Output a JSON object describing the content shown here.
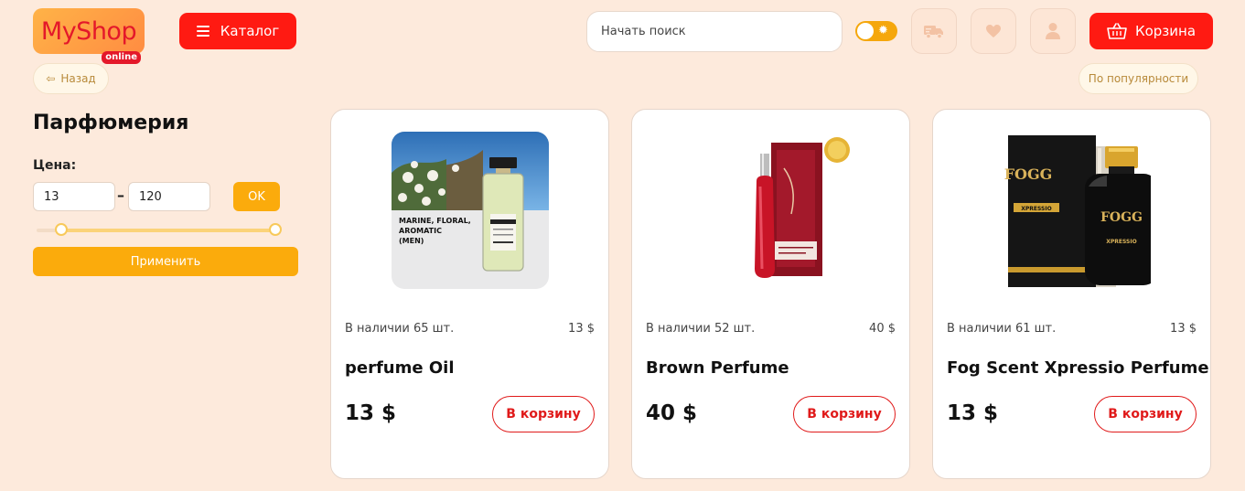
{
  "header": {
    "logo": "MyShop",
    "logo_badge": "online",
    "catalog_label": "Каталог",
    "search_placeholder": "Начать поиск",
    "cart_label": "Корзина",
    "icons": [
      "truck-icon",
      "heart-icon",
      "user-icon",
      "basket-icon"
    ]
  },
  "nav": {
    "back_label": "Назад",
    "sort_label": "По популярности"
  },
  "sidebar": {
    "category_title": "Парфюмерия",
    "price_label": "Цена:",
    "price_from": "13",
    "price_to": "120",
    "ok_label": "OK",
    "apply_label": "Применить",
    "range_fraction": [
      0.1,
      0.98
    ]
  },
  "products": [
    {
      "name": "perfume Oil",
      "stock": "В наличии 65 шт.",
      "price_small": "13 $",
      "price": "13 $",
      "add_label": "В корзину",
      "image_text": [
        "MARINE, FLORAL,",
        "AROMATIC",
        "(MEN)"
      ]
    },
    {
      "name": "Brown Perfume",
      "stock": "В наличии 52 шт.",
      "price_small": "40 $",
      "price": "40 $",
      "add_label": "В корзину"
    },
    {
      "name": "Fog Scent Xpressio Perfume",
      "stock": "В наличии 61 шт.",
      "price_small": "13 $",
      "price": "13 $",
      "add_label": "В корзину",
      "image_text": [
        "FOGG",
        "XPRESSIO",
        "FOGG",
        "XPRESSIO"
      ]
    }
  ],
  "colors": {
    "background": "#fdeadc",
    "accent_red": "#ff1a12",
    "accent_orange": "#fbab0c"
  }
}
